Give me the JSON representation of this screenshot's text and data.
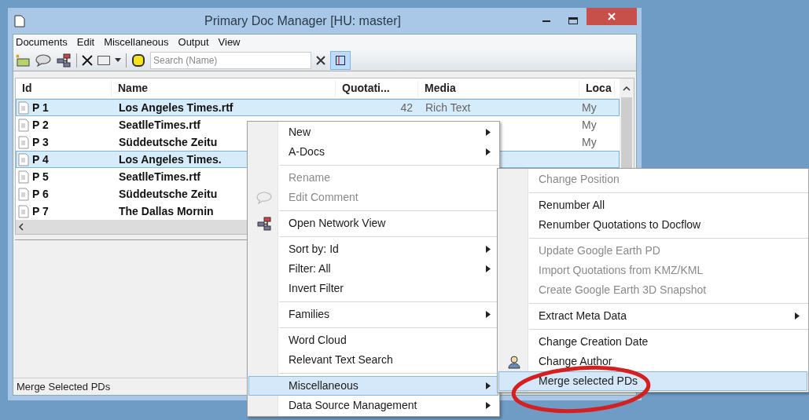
{
  "window": {
    "title": "Primary Doc Manager [HU: master]"
  },
  "menubar": [
    "Documents",
    "Edit",
    "Miscellaneous",
    "Output",
    "View"
  ],
  "search": {
    "placeholder": "Search (Name)"
  },
  "split_toggle": {
    "on": true
  },
  "table": {
    "columns": [
      "Id",
      "Name",
      "Quotati...",
      "Media",
      "Loca"
    ],
    "rows": [
      {
        "id": "P 1",
        "name": "Los Angeles Times.rtf",
        "quotations": "42",
        "media": "Rich Text",
        "location": "My",
        "selected": true
      },
      {
        "id": "P 2",
        "name": "SeatlleTimes.rtf",
        "location": "My",
        "selected": false
      },
      {
        "id": "P 3",
        "name": "Süddeutsche Zeitu",
        "location": "My",
        "selected": false
      },
      {
        "id": "P 4",
        "name": "Los Angeles Times.",
        "selected": true
      },
      {
        "id": "P 5",
        "name": "SeatlleTimes.rtf",
        "selected": false
      },
      {
        "id": "P 6",
        "name": "Süddeutsche Zeitu",
        "selected": false
      },
      {
        "id": "P 7",
        "name": "The Dallas Mornin",
        "selected": false
      }
    ]
  },
  "status_bar": "Merge Selected PDs",
  "context_menu": [
    {
      "kind": "item",
      "label": "New",
      "submenu": true,
      "disabled": false,
      "selected": false
    },
    {
      "kind": "item",
      "label": "A-Docs",
      "submenu": true,
      "disabled": false,
      "selected": false
    },
    {
      "kind": "separator"
    },
    {
      "kind": "item",
      "label": "Rename",
      "submenu": false,
      "disabled": true,
      "selected": false
    },
    {
      "kind": "item",
      "label": "Edit Comment",
      "submenu": false,
      "disabled": true,
      "selected": false
    },
    {
      "kind": "separator"
    },
    {
      "kind": "item",
      "label": "Open Network View",
      "submenu": false,
      "disabled": false,
      "selected": false
    },
    {
      "kind": "separator"
    },
    {
      "kind": "item",
      "label": "Sort by: Id",
      "submenu": true,
      "disabled": false,
      "selected": false
    },
    {
      "kind": "item",
      "label": "Filter: All",
      "submenu": true,
      "disabled": false,
      "selected": false
    },
    {
      "kind": "item",
      "label": "Invert Filter",
      "submenu": false,
      "disabled": false,
      "selected": false
    },
    {
      "kind": "separator"
    },
    {
      "kind": "item",
      "label": "Families",
      "submenu": true,
      "disabled": false,
      "selected": false
    },
    {
      "kind": "separator"
    },
    {
      "kind": "item",
      "label": "Word Cloud",
      "submenu": false,
      "disabled": false,
      "selected": false
    },
    {
      "kind": "item",
      "label": "Relevant Text Search",
      "submenu": false,
      "disabled": false,
      "selected": false
    },
    {
      "kind": "separator"
    },
    {
      "kind": "item",
      "label": "Miscellaneous",
      "submenu": true,
      "disabled": false,
      "selected": true
    },
    {
      "kind": "item",
      "label": "Data Source Management",
      "submenu": true,
      "disabled": false,
      "selected": false
    }
  ],
  "submenu": [
    {
      "kind": "item",
      "label": "Change Position",
      "submenu": false,
      "disabled": true,
      "selected": false
    },
    {
      "kind": "separator"
    },
    {
      "kind": "item",
      "label": "Renumber All",
      "submenu": false,
      "disabled": false,
      "selected": false
    },
    {
      "kind": "item",
      "label": "Renumber Quotations to Docflow",
      "submenu": false,
      "disabled": false,
      "selected": false
    },
    {
      "kind": "separator"
    },
    {
      "kind": "item",
      "label": "Update Google Earth PD",
      "submenu": false,
      "disabled": true,
      "selected": false
    },
    {
      "kind": "item",
      "label": "Import Quotations from KMZ/KML",
      "submenu": false,
      "disabled": true,
      "selected": false
    },
    {
      "kind": "item",
      "label": "Create Google Earth 3D Snapshot",
      "submenu": false,
      "disabled": true,
      "selected": false
    },
    {
      "kind": "separator"
    },
    {
      "kind": "item",
      "label": "Extract Meta Data",
      "submenu": true,
      "disabled": false,
      "selected": false
    },
    {
      "kind": "separator"
    },
    {
      "kind": "item",
      "label": "Change Creation Date",
      "submenu": false,
      "disabled": false,
      "selected": false
    },
    {
      "kind": "item",
      "label": "Change Author",
      "submenu": false,
      "disabled": false,
      "selected": false
    },
    {
      "kind": "item",
      "label": "Merge selected PDs",
      "submenu": false,
      "disabled": false,
      "selected": true
    }
  ]
}
